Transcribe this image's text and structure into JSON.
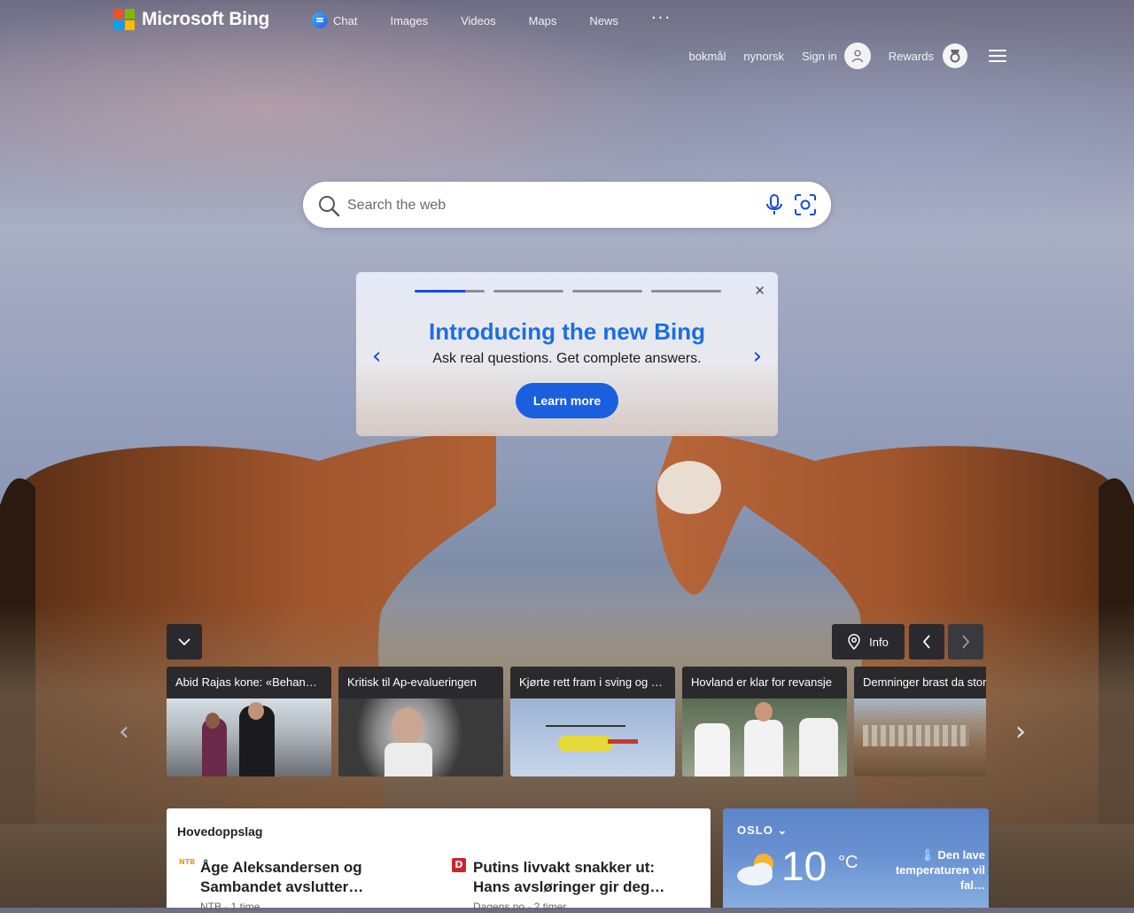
{
  "header": {
    "logo_text": "Microsoft Bing",
    "logo_colors": [
      "#f25022",
      "#7fba00",
      "#00a4ef",
      "#ffb900"
    ],
    "nav": [
      {
        "label": "Chat",
        "icon": "chat-icon"
      },
      {
        "label": "Images"
      },
      {
        "label": "Videos"
      },
      {
        "label": "Maps"
      },
      {
        "label": "News"
      }
    ],
    "more_label": "···",
    "languages": [
      "bokmål",
      "nynorsk"
    ],
    "sign_in_label": "Sign in",
    "rewards_label": "Rewards"
  },
  "search": {
    "placeholder": "Search the web"
  },
  "promo": {
    "title": "Introducing the new Bing",
    "subtitle": "Ask real questions. Get complete answers.",
    "cta_label": "Learn more",
    "slide_index": 1,
    "slide_count": 4,
    "accent_color": "#1a5fe0"
  },
  "carousel": {
    "info_label": "Info",
    "items": [
      "Abid Rajas kone: «Behandlet som en håndveske»",
      "Kritisk til Ap-evalueringen",
      "Kjørte rett fram i sving og havnet i elven",
      "Hovland er klar for revansje",
      "Demninger brast da stormen traff"
    ]
  },
  "headlines": {
    "title": "Hovedoppslag",
    "stories": [
      {
        "source_logo": "NTB",
        "headline": "Åge Aleksandersen og Sambandet avslutter…",
        "meta": "NTB · 1 time"
      },
      {
        "source_logo": "D",
        "headline": "Putins livvakt snakker ut: Hans avsløringer gir deg…",
        "meta": "Dagens no · 2 timer"
      }
    ]
  },
  "weather": {
    "city": "OSLO",
    "temperature": "10",
    "unit": "°C",
    "condition_icon": "partly-cloudy-icon",
    "alert": "Den lave temperaturen vil fal…",
    "alert_icon": "thermometer-icon"
  }
}
